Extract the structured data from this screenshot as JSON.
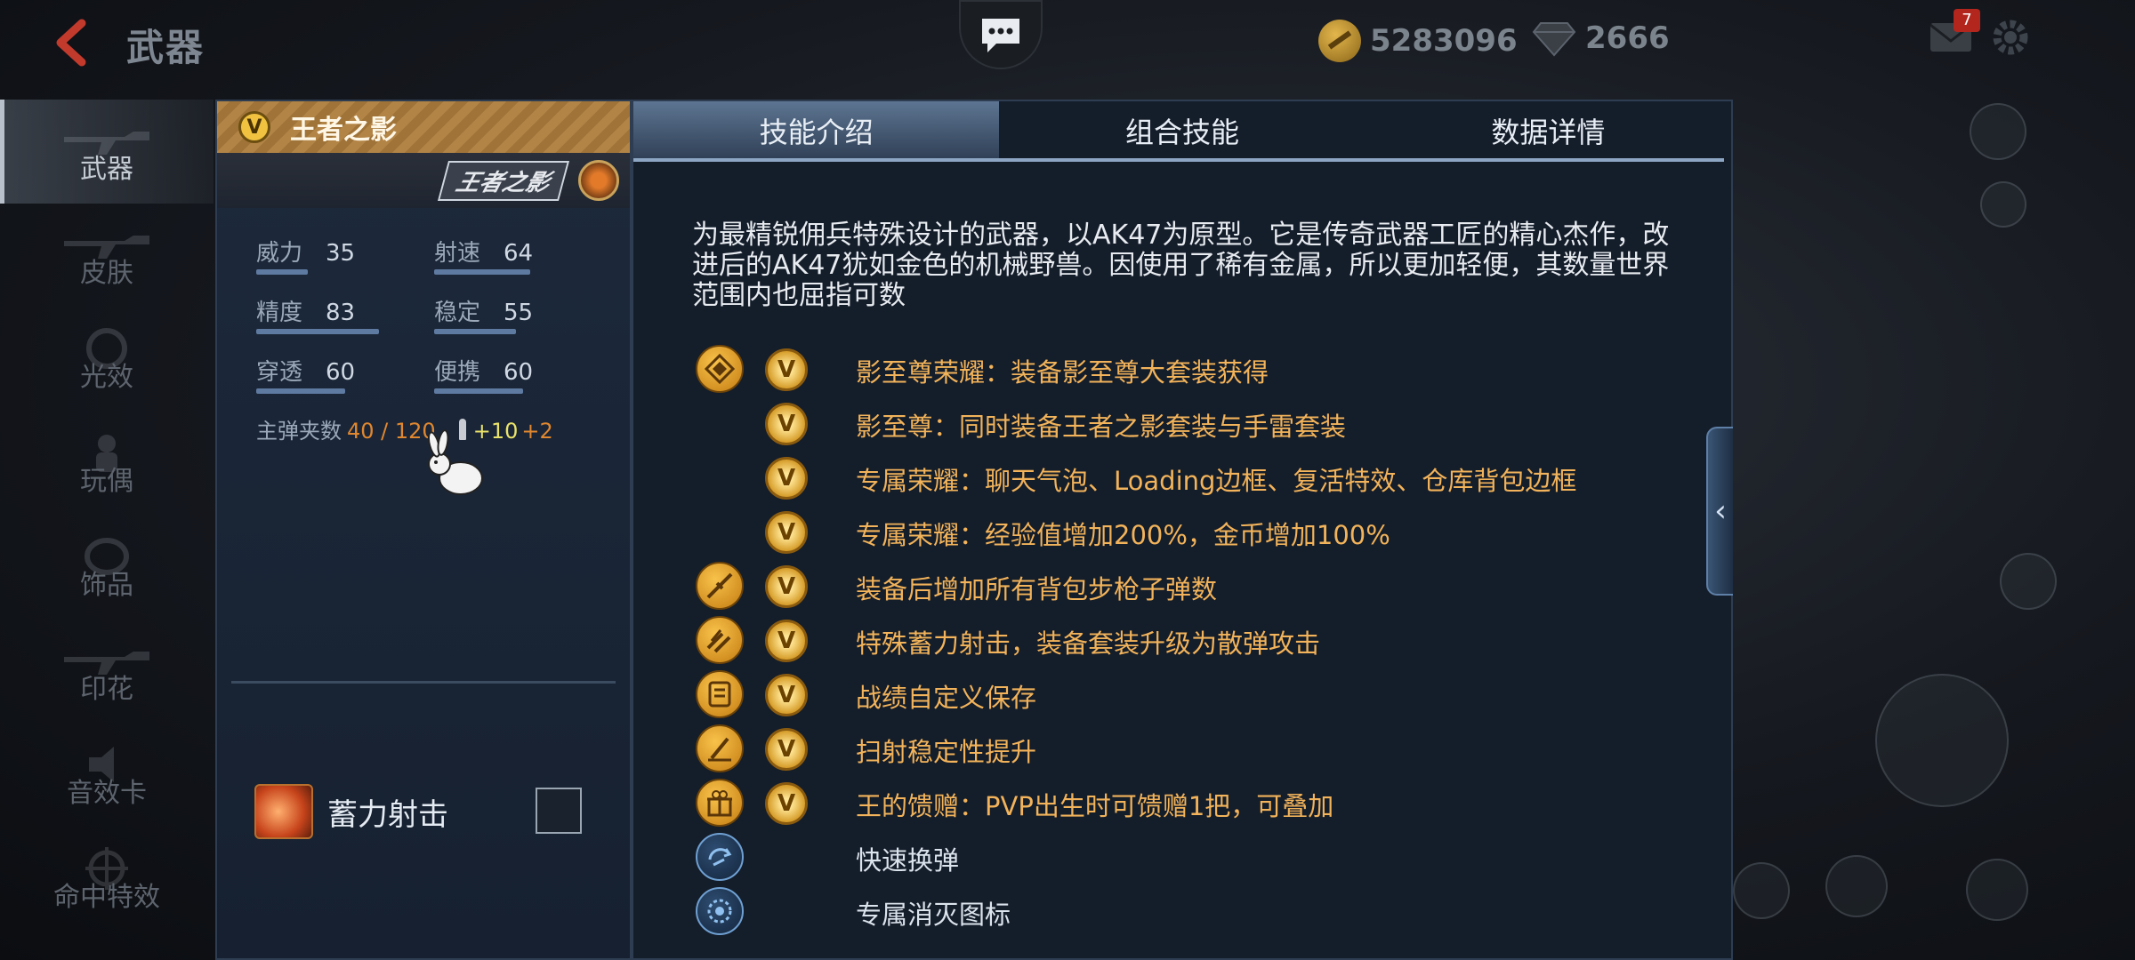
{
  "header": {
    "title": "武器",
    "coins": "5283096",
    "gems": "2666",
    "mail_count": "7"
  },
  "nav": {
    "items": [
      {
        "label": "武器",
        "icon": "rifle-icon",
        "active": true
      },
      {
        "label": "皮肤",
        "icon": "skin-icon",
        "active": false
      },
      {
        "label": "光效",
        "icon": "light-effect-icon",
        "active": false
      },
      {
        "label": "玩偶",
        "icon": "doll-icon",
        "active": false
      },
      {
        "label": "饰品",
        "icon": "accessory-icon",
        "active": false
      },
      {
        "label": "印花",
        "icon": "decal-icon",
        "active": false
      },
      {
        "label": "音效卡",
        "icon": "sound-card-icon",
        "active": false
      },
      {
        "label": "命中特效",
        "icon": "hit-effect-icon",
        "active": false
      }
    ]
  },
  "weapon": {
    "vip_badge": "V",
    "name": "王者之影",
    "logo_text": "王者之影",
    "stats": [
      {
        "label": "威力",
        "value": "35"
      },
      {
        "label": "射速",
        "value": "64"
      },
      {
        "label": "精度",
        "value": "83"
      },
      {
        "label": "稳定",
        "value": "55"
      },
      {
        "label": "穿透",
        "value": "60"
      },
      {
        "label": "便携",
        "value": "60"
      }
    ],
    "ammo_label": "主弹夹数",
    "ammo_value": "40 / 120",
    "ammo_extra1": "+10",
    "ammo_extra2": "+2",
    "skill_name": "蓄力射击"
  },
  "tabs": [
    {
      "label": "技能介绍",
      "active": true
    },
    {
      "label": "组合技能",
      "active": false
    },
    {
      "label": "数据详情",
      "active": false
    }
  ],
  "detail": {
    "description": "为最精锐佣兵特殊设计的武器，以AK47为原型。它是传奇武器工匠的精心杰作，改进后的AK47犹如金色的机械野兽。因使用了稀有金属，所以更加轻便，其数量世界范围内也屈指可数",
    "features": [
      {
        "icon": "honor-icon",
        "vip": true,
        "text": "影至尊荣耀：装备影至尊大套装获得",
        "style": "gold"
      },
      {
        "icon": "",
        "vip": true,
        "text": "影至尊：同时装备王者之影套装与手雷套装",
        "style": "gold"
      },
      {
        "icon": "",
        "vip": true,
        "text": "专属荣耀：聊天气泡、Loading边框、复活特效、仓库背包边框",
        "style": "gold"
      },
      {
        "icon": "",
        "vip": true,
        "text": "专属荣耀：经验值增加200%，金币增加100%",
        "style": "gold"
      },
      {
        "icon": "rifle-ammo-icon",
        "vip": true,
        "text": "装备后增加所有背包步枪子弹数",
        "style": "gold"
      },
      {
        "icon": "charge-shot-icon",
        "vip": true,
        "text": "特殊蓄力射击，装备套装升级为散弹攻击",
        "style": "gold"
      },
      {
        "icon": "record-save-icon",
        "vip": true,
        "text": "战绩自定义保存",
        "style": "gold"
      },
      {
        "icon": "stability-icon",
        "vip": true,
        "text": "扫射稳定性提升",
        "style": "gold"
      },
      {
        "icon": "gift-icon",
        "vip": true,
        "text": "王的馈赠：PVP出生时可馈赠1把，可叠加",
        "style": "gold"
      },
      {
        "icon": "quick-reload-icon",
        "vip": false,
        "text": "快速换弹",
        "style": "white"
      },
      {
        "icon": "kill-icon",
        "vip": false,
        "text": "专属消灭图标",
        "style": "white"
      }
    ]
  },
  "colors": {
    "accent_gold": "#f2b35a",
    "panel_bg": "#141d2a",
    "tab_active": "#5d7592"
  }
}
